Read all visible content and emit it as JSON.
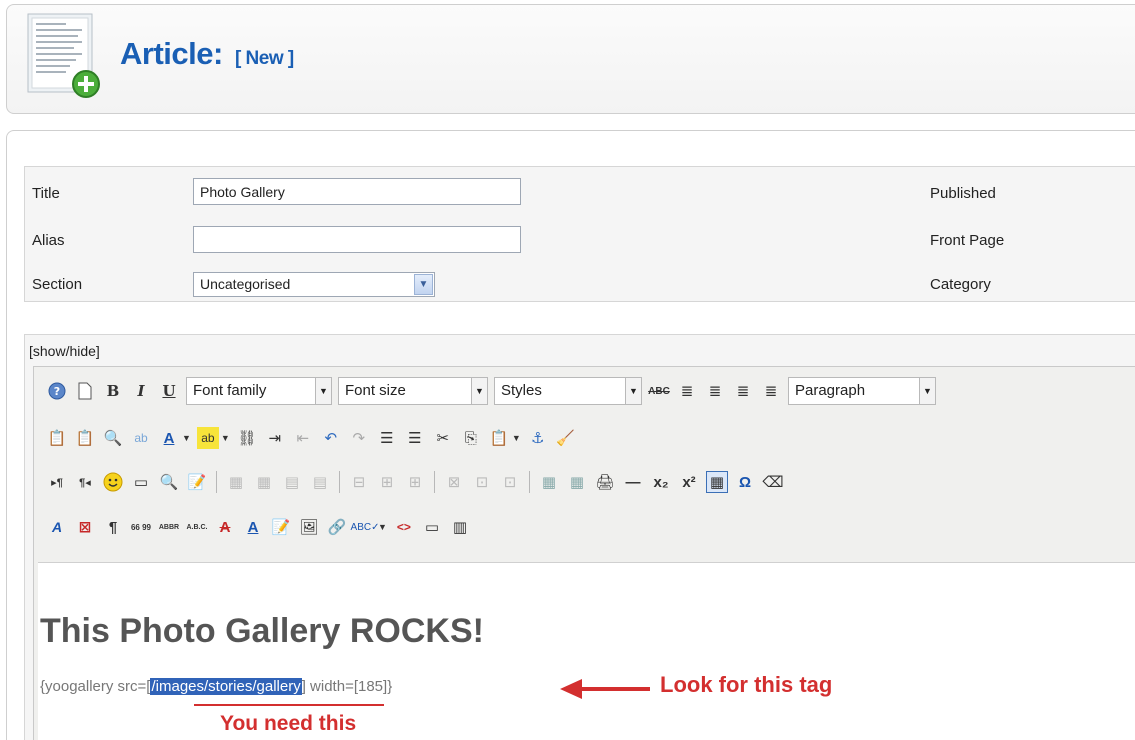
{
  "header": {
    "title": "Article:",
    "status": "[ New ]"
  },
  "details": {
    "title_label": "Title",
    "title_value": "Photo Gallery",
    "alias_label": "Alias",
    "alias_value": "",
    "section_label": "Section",
    "section_value": "Uncategorised",
    "published_label": "Published",
    "frontpage_label": "Front Page",
    "category_label": "Category"
  },
  "editor": {
    "show_hide": "[show/hide]",
    "font_family": "Font family",
    "font_size": "Font size",
    "styles": "Styles",
    "block_format": "Paragraph",
    "content_heading": "This Photo Gallery ROCKS!",
    "tag_prefix": "{yoogallery src=[",
    "tag_selected": "/images/stories/gallery",
    "tag_suffix": "] width=[185]}"
  },
  "annotations": {
    "look_for": "Look for this tag",
    "you_need": "You need this"
  },
  "colors": {
    "title_blue": "#1a5fb4",
    "annotation_red": "#d32f2f",
    "selection_blue": "#3063b8"
  }
}
